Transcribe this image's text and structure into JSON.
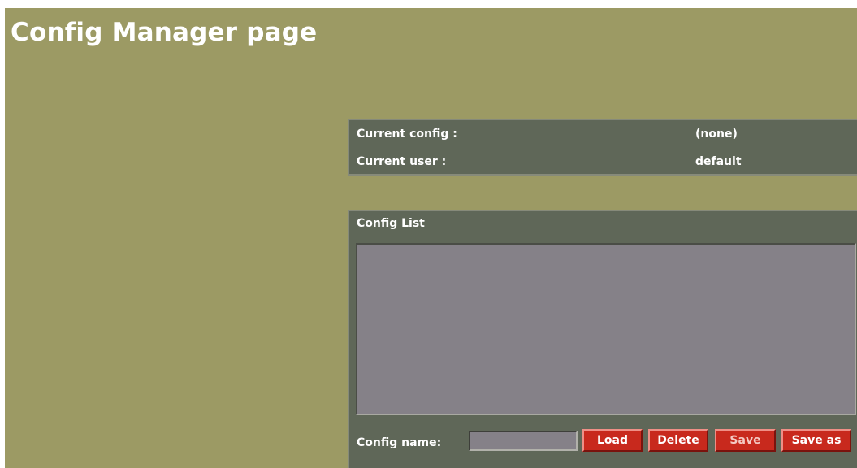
{
  "page": {
    "title": "Config Manager page"
  },
  "info": {
    "current_config_label": "Current config :",
    "current_config_value": "(none)",
    "current_user_label": "Current user :",
    "current_user_value": "default"
  },
  "config_list": {
    "title": "Config List",
    "items": []
  },
  "config_name": {
    "label": "Config name:",
    "value": "",
    "placeholder": ""
  },
  "buttons": {
    "load": "Load",
    "delete": "Delete",
    "save": "Save",
    "save_as": "Save as"
  },
  "colors": {
    "page_background": "#9c9a64",
    "panel_background": "#5f6758",
    "list_background": "#858188",
    "button_red": "#c8291d",
    "text": "#ffffff"
  }
}
